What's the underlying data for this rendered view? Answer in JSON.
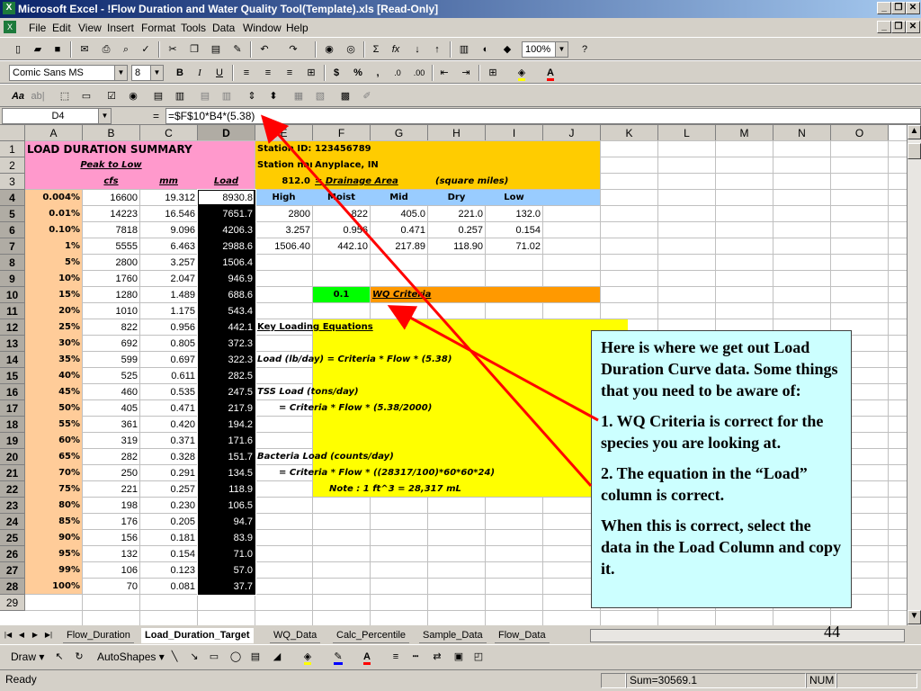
{
  "window": {
    "title": "Microsoft Excel - !Flow Duration and Water Quality Tool(Template).xls  [Read-Only]"
  },
  "menu": [
    "File",
    "Edit",
    "View",
    "Insert",
    "Format",
    "Tools",
    "Data",
    "Window",
    "Help"
  ],
  "toolbar": {
    "zoom": "100%",
    "font": "Comic Sans MS",
    "size": "8"
  },
  "formula_bar": {
    "name_box": "D4",
    "eq": "=",
    "formula": "=$F$10*B4*(5.38)"
  },
  "columns": [
    "A",
    "B",
    "C",
    "D",
    "E",
    "F",
    "G",
    "H",
    "I",
    "J",
    "K",
    "L",
    "M",
    "N",
    "O"
  ],
  "rows": [
    "1",
    "2",
    "3",
    "4",
    "5",
    "6",
    "7",
    "8",
    "9",
    "10",
    "11",
    "12",
    "13",
    "14",
    "15",
    "16",
    "17",
    "18",
    "19",
    "20",
    "21",
    "22",
    "23",
    "24",
    "25",
    "26",
    "27",
    "28",
    "29"
  ],
  "summary": {
    "title": "LOAD DURATION SUMMARY",
    "peak": "Peak to Low",
    "cfs": "cfs",
    "mm": "mm",
    "load": "Load"
  },
  "table": [
    [
      "0.004%",
      "16600",
      "19.312",
      "8930.8"
    ],
    [
      "0.01%",
      "14223",
      "16.546",
      "7651.7"
    ],
    [
      "0.10%",
      "7818",
      "9.096",
      "4206.3"
    ],
    [
      "1%",
      "5555",
      "6.463",
      "2988.6"
    ],
    [
      "5%",
      "2800",
      "3.257",
      "1506.4"
    ],
    [
      "10%",
      "1760",
      "2.047",
      "946.9"
    ],
    [
      "15%",
      "1280",
      "1.489",
      "688.6"
    ],
    [
      "20%",
      "1010",
      "1.175",
      "543.4"
    ],
    [
      "25%",
      "822",
      "0.956",
      "442.1"
    ],
    [
      "30%",
      "692",
      "0.805",
      "372.3"
    ],
    [
      "35%",
      "599",
      "0.697",
      "322.3"
    ],
    [
      "40%",
      "525",
      "0.611",
      "282.5"
    ],
    [
      "45%",
      "460",
      "0.535",
      "247.5"
    ],
    [
      "50%",
      "405",
      "0.471",
      "217.9"
    ],
    [
      "55%",
      "361",
      "0.420",
      "194.2"
    ],
    [
      "60%",
      "319",
      "0.371",
      "171.6"
    ],
    [
      "65%",
      "282",
      "0.328",
      "151.7"
    ],
    [
      "70%",
      "250",
      "0.291",
      "134.5"
    ],
    [
      "75%",
      "221",
      "0.257",
      "118.9"
    ],
    [
      "80%",
      "198",
      "0.230",
      "106.5"
    ],
    [
      "85%",
      "176",
      "0.205",
      "94.7"
    ],
    [
      "90%",
      "156",
      "0.181",
      "83.9"
    ],
    [
      "95%",
      "132",
      "0.154",
      "71.0"
    ],
    [
      "99%",
      "106",
      "0.123",
      "57.0"
    ],
    [
      "100%",
      "70",
      "0.081",
      "37.7"
    ]
  ],
  "station": {
    "id_label": "Station ID:",
    "id": "123456789",
    "name_label": "Station name:",
    "name": "Anyplace, IN",
    "area": "812.0",
    "area_label": "= Drainage Area",
    "area_unit": "(square miles)"
  },
  "flow_headers": [
    "High",
    "Moist",
    "Mid",
    "Dry",
    "Low"
  ],
  "flow_rows": [
    [
      "2800",
      "822",
      "405.0",
      "221.0",
      "132.0"
    ],
    [
      "3.257",
      "0.956",
      "0.471",
      "0.257",
      "0.154"
    ],
    [
      "1506.40",
      "442.10",
      "217.89",
      "118.90",
      "71.02"
    ]
  ],
  "wq": {
    "value": "0.1",
    "label": "WQ Criteria"
  },
  "equations": {
    "title": "Key Loading Equations",
    "load": "Load (lb/day) = Criteria * Flow * (5.38)",
    "tss1": "TSS Load (tons/day)",
    "tss2": "= Criteria * Flow * (5.38/2000)",
    "bac1": "Bacteria Load (counts/day)",
    "bac2": "= Criteria * Flow * ((28317/100)*60*60*24)",
    "note": "Note :   1 ft^3 = 28,317 mL"
  },
  "callout": {
    "p1": "Here is where we get out Load Duration Curve data.  Some things that you need to be aware of:",
    "p2": "1.  WQ Criteria is correct for the species you are looking at.",
    "p3": "2.  The equation in the “Load” column is correct.",
    "p4": "When this is correct, select the data in the Load Column and copy it."
  },
  "sheet_tabs": [
    "Flow_Duration",
    "Load_Duration_Target",
    "WQ_Data",
    "Calc_Percentile",
    "Sample_Data",
    "Flow_Data"
  ],
  "draw": {
    "draw": "Draw",
    "autoshapes": "AutoShapes"
  },
  "status": {
    "ready": "Ready",
    "sum": "Sum=30569.1",
    "num": "NUM"
  },
  "slide_number": "44",
  "colors": {
    "pink": "#ff99cc",
    "tan": "#ffcc99",
    "gold": "#ffcc00",
    "blue": "#99ccff",
    "green": "#00ff00",
    "orange": "#ff9900",
    "yellow": "#ffff00",
    "arrow": "#ff0000"
  }
}
